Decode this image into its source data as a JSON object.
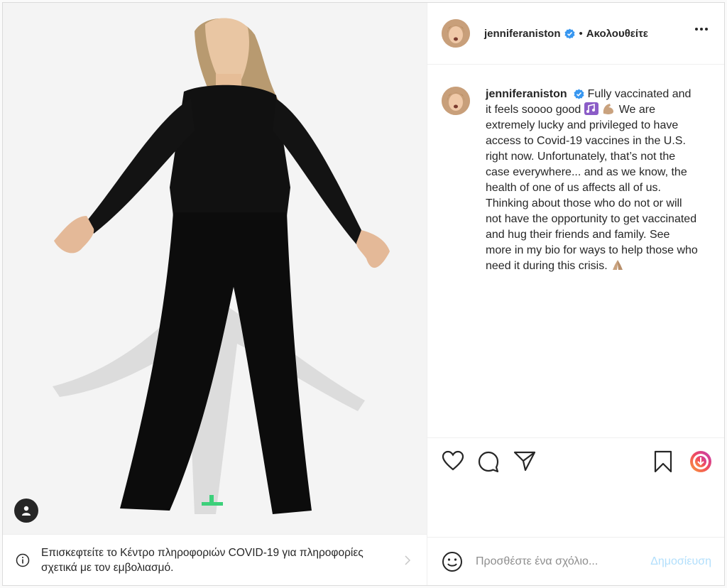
{
  "post": {
    "username": "jenniferaniston",
    "follow_status": "Ακολουθείτε",
    "separator": "•",
    "caption_user": "jenniferaniston",
    "caption_part1": "Fully vaccinated and it feels soooo good",
    "caption_part2": "We are extremely lucky and privileged to have access to Covid-19 vaccines in the U.S. right now. Unfortunately, that’s not the case everywhere... and as we know, the health of one of us affects all of us. Thinking about those who do not or will not have the opportunity to get vaccinated and hug their friends and family. See more in my bio for ways to help those who need it during this crisis."
  },
  "covid_banner": {
    "text": "Επισκεφτείτε το Κέντρο πληροφοριών COVID-19 για πληροφορίες σχετικά με τον εμβολιασμό."
  },
  "comment": {
    "placeholder": "Προσθέστε ένα σχόλιο...",
    "post_label": "Δημοσίευση"
  },
  "colors": {
    "verified": "#3897f0",
    "post_button_disabled": "#b2dffc",
    "text": "#262626"
  },
  "icons": {
    "verified": "verified-badge-icon",
    "more": "more-options-icon",
    "like": "heart-icon",
    "comment": "comment-bubble-icon",
    "share": "paper-plane-icon",
    "save": "bookmark-icon",
    "download": "download-circle-icon",
    "emoji": "smiley-icon",
    "info": "info-icon",
    "chevron": "chevron-right-icon",
    "tag": "user-tag-icon"
  }
}
